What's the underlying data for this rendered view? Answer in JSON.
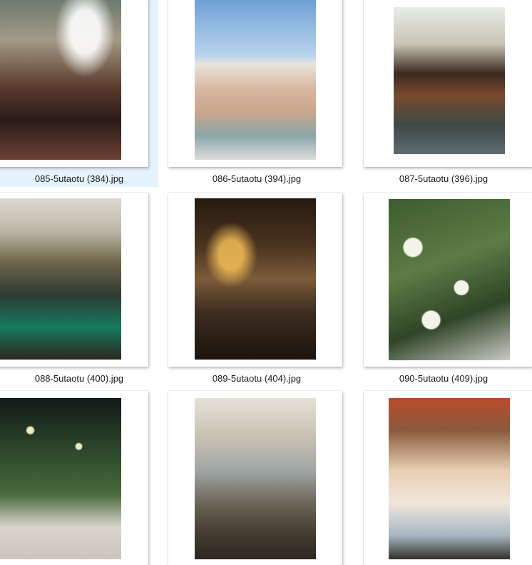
{
  "files": [
    {
      "name": "085-5utaotu (384).jpg",
      "selected": true
    },
    {
      "name": "086-5utaotu (394).jpg",
      "selected": false
    },
    {
      "name": "087-5utaotu (396).jpg",
      "selected": false
    },
    {
      "name": "088-5utaotu (400).jpg",
      "selected": false
    },
    {
      "name": "089-5utaotu (404).jpg",
      "selected": false
    },
    {
      "name": "090-5utaotu (409).jpg",
      "selected": false
    },
    {
      "name": "",
      "selected": false
    },
    {
      "name": "",
      "selected": false
    },
    {
      "name": "",
      "selected": false
    }
  ],
  "colors": {
    "selection": "#e5f3ff",
    "label_text": "#1a1a1a",
    "background": "#ffffff"
  },
  "icons": {
    "thumbnail": "image-thumbnail-icon"
  }
}
